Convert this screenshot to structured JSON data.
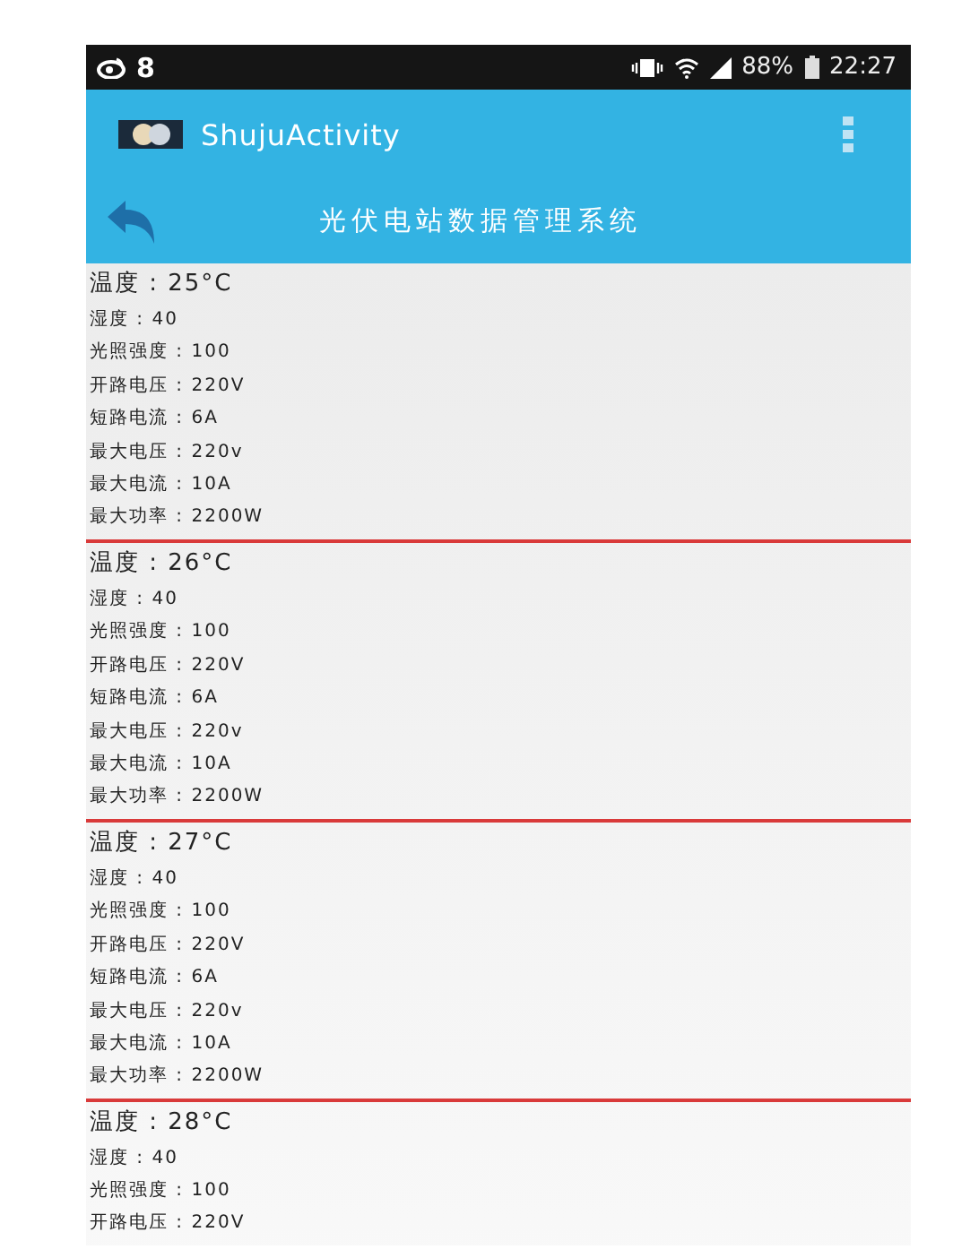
{
  "status_bar": {
    "notification": "8",
    "battery": "88%",
    "time": "22:27"
  },
  "action_bar": {
    "title": "ShujuActivity"
  },
  "header": {
    "title": "光伏电站数据管理系统"
  },
  "records": [
    {
      "heading": "温度 : 25°C",
      "lines": [
        "湿度 : 40",
        "光照强度 : 100",
        "开路电压 : 220V",
        "短路电流 : 6A",
        "最大电压 : 220v",
        "最大电流 : 10A",
        "最大功率 : 2200W"
      ]
    },
    {
      "heading": "温度 : 26°C",
      "lines": [
        "湿度 : 40",
        "光照强度 : 100",
        "开路电压 : 220V",
        "短路电流 : 6A",
        "最大电压 : 220v",
        "最大电流 : 10A",
        "最大功率 : 2200W"
      ]
    },
    {
      "heading": "温度 : 27°C",
      "lines": [
        "湿度 : 40",
        "光照强度 : 100",
        "开路电压 : 220V",
        "短路电流 : 6A",
        "最大电压 : 220v",
        "最大电流 : 10A",
        "最大功率 : 2200W"
      ]
    },
    {
      "heading": "温度 : 28°C",
      "lines": [
        "湿度 : 40",
        "光照强度 : 100",
        "开路电压 : 220V"
      ]
    }
  ]
}
